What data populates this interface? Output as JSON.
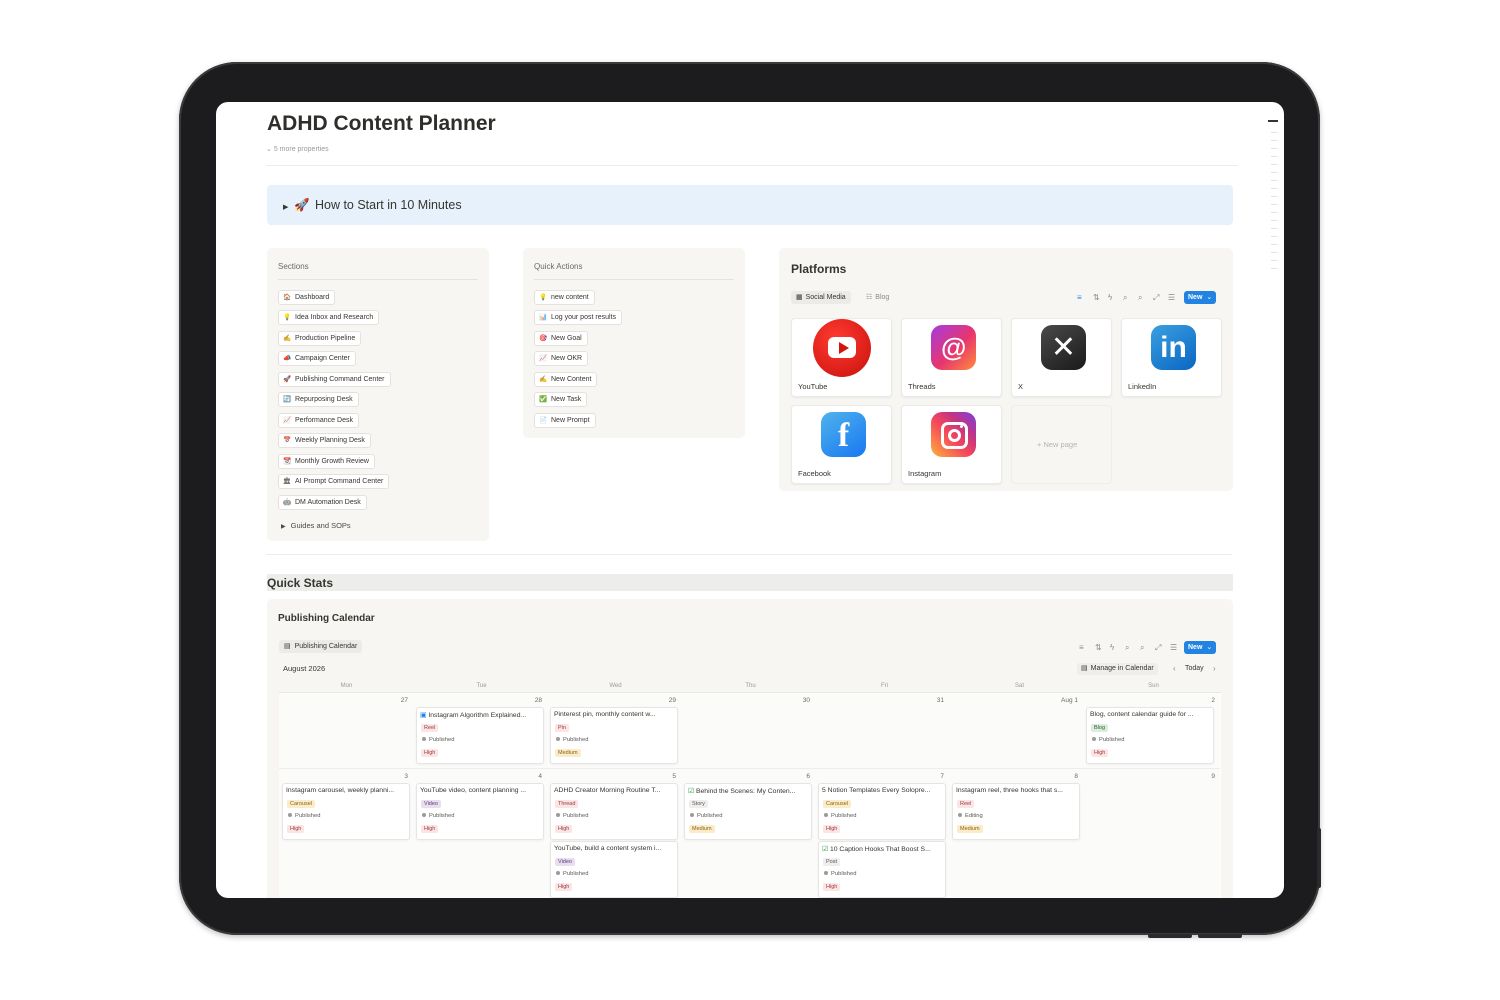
{
  "page": {
    "title": "ADHD Content Planner",
    "more_properties": "5 more properties"
  },
  "callout": {
    "icon": "rocket-icon",
    "text": "How to Start in 10 Minutes"
  },
  "sections": {
    "heading": "Sections",
    "items": [
      {
        "label": "Dashboard",
        "icon": "house-icon"
      },
      {
        "label": "Idea Inbox and Research",
        "icon": "lightbulb-icon"
      },
      {
        "label": "Production Pipeline",
        "icon": "pencil-icon"
      },
      {
        "label": "Campaign Center",
        "icon": "megaphone-icon"
      },
      {
        "label": "Publishing Command Center",
        "icon": "rocket-icon"
      },
      {
        "label": "Repurposing Desk",
        "icon": "recycle-icon"
      },
      {
        "label": "Performance Desk",
        "icon": "chart-icon"
      },
      {
        "label": "Weekly Planning Desk",
        "icon": "calendar-icon"
      },
      {
        "label": "Monthly Growth Review",
        "icon": "calendar-icon"
      },
      {
        "label": "AI Prompt Command Center",
        "icon": "building-icon"
      },
      {
        "label": "DM Automation Desk",
        "icon": "robot-icon"
      }
    ],
    "toggle": "Guides and SOPs"
  },
  "quick_actions": {
    "heading": "Quick Actions",
    "items": [
      {
        "label": "new content",
        "icon": "lightbulb-icon"
      },
      {
        "label": "Log your post results",
        "icon": "bar-chart-icon"
      },
      {
        "label": "New Goal",
        "icon": "target-icon"
      },
      {
        "label": "New OKR",
        "icon": "chart-icon"
      },
      {
        "label": "New Content",
        "icon": "pencil-icon"
      },
      {
        "label": "New Task",
        "icon": "checkbox-icon"
      },
      {
        "label": "New Prompt",
        "icon": "document-icon"
      }
    ]
  },
  "platforms": {
    "title": "Platforms",
    "tabs": [
      "Social Media",
      "Blog"
    ],
    "new_label": "New",
    "cards": [
      {
        "label": "YouTube",
        "icon": "youtube-icon"
      },
      {
        "label": "Threads",
        "icon": "threads-icon"
      },
      {
        "label": "X",
        "icon": "x-icon"
      },
      {
        "label": "LinkedIn",
        "icon": "linkedin-icon"
      },
      {
        "label": "Facebook",
        "icon": "facebook-icon"
      },
      {
        "label": "Instagram",
        "icon": "instagram-icon"
      }
    ],
    "new_page": "New page"
  },
  "quick_stats": {
    "heading": "Quick Stats"
  },
  "calendar": {
    "title": "Publishing Calendar",
    "view_tab": "Publishing Calendar",
    "new_label": "New",
    "month": "August 2026",
    "manage": "Manage in Calendar",
    "today": "Today",
    "weekdays": [
      "Mon",
      "Tue",
      "Wed",
      "Thu",
      "Fri",
      "Sat",
      "Sun"
    ],
    "week1_days": [
      "27",
      "28",
      "29",
      "30",
      "31",
      "Aug 1",
      "2"
    ],
    "week2_days": [
      "3",
      "4",
      "5",
      "6",
      "7",
      "8",
      "9"
    ],
    "events": [
      {
        "title": "Instagram Algorithm Explained...",
        "type": "Reel",
        "status": "Published",
        "priority": "High"
      },
      {
        "title": "Pinterest pin, monthly content w...",
        "type": "Pin",
        "status": "Published",
        "priority": "Medium"
      },
      {
        "title": "Blog, content calendar guide for ...",
        "type": "Blog",
        "status": "Published",
        "priority": "High"
      },
      {
        "title": "Instagram carousel, weekly planni...",
        "type": "Carousel",
        "status": "Published",
        "priority": "High"
      },
      {
        "title": "YouTube video, content planning ...",
        "type": "Video",
        "status": "Published",
        "priority": "High"
      },
      {
        "title": "ADHD Creator Morning Routine T...",
        "type": "Thread",
        "status": "Published",
        "priority": "High"
      },
      {
        "title": "Behind the Scenes: My Conten...",
        "type": "Story",
        "status": "Published",
        "priority": "Medium"
      },
      {
        "title": "5 Notion Templates Every Solopre...",
        "type": "Carousel",
        "status": "Published",
        "priority": "High"
      },
      {
        "title": "Instagram reel, three hooks that s...",
        "type": "Reel",
        "status": "Editing",
        "priority": "Medium"
      },
      {
        "title": "YouTube, build a content system i...",
        "type": "Video",
        "status": "Published",
        "priority": "High"
      },
      {
        "title": "10 Caption Hooks That Boost S...",
        "type": "Post",
        "status": "Published",
        "priority": "High"
      }
    ]
  },
  "colors": {
    "accent": "#2383e2",
    "callout_bg": "#e7f1fb",
    "panel_bg": "#f7f6f3",
    "bezel": "#1c1c1e"
  }
}
